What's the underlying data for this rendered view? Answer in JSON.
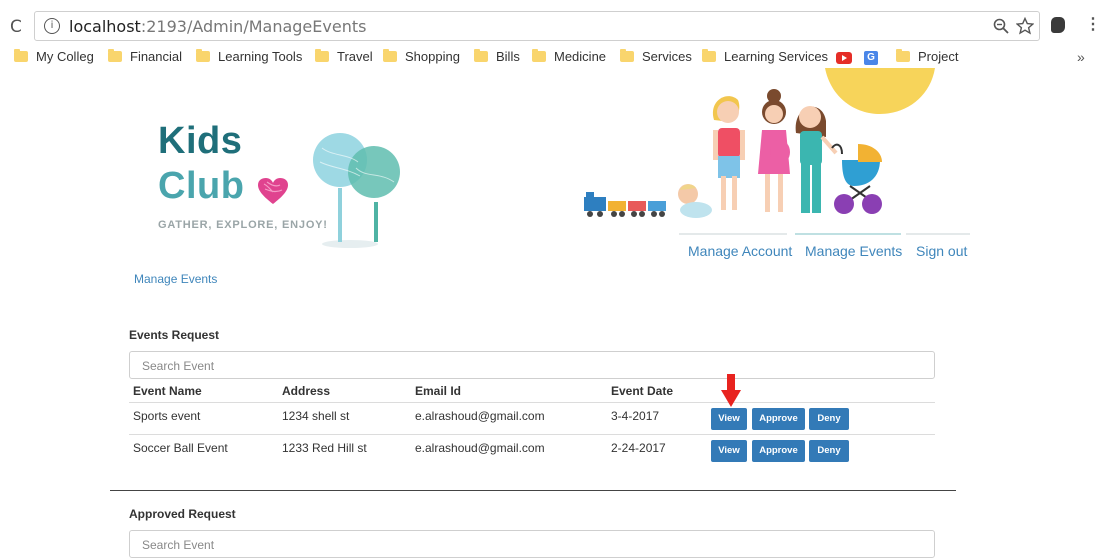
{
  "browser": {
    "url_host": "localhost",
    "url_path": ":2193/Admin/ManageEvents",
    "bookmarks": [
      {
        "label": "My Colleg"
      },
      {
        "label": "Financial"
      },
      {
        "label": "Learning Tools"
      },
      {
        "label": "Travel"
      },
      {
        "label": "Shopping"
      },
      {
        "label": "Bills"
      },
      {
        "label": "Medicine"
      },
      {
        "label": "Services"
      },
      {
        "label": "Learning Services"
      },
      {
        "label": "Project"
      }
    ],
    "more_bookmarks": "»",
    "icons": [
      "reload-icon",
      "info-icon",
      "zoom-icon",
      "star-icon",
      "extension-icon",
      "menu-icon",
      "youtube-icon",
      "translate-icon"
    ]
  },
  "brand": {
    "line1": "Kids",
    "line2": "Club",
    "tagline": "GATHER, EXPLORE, ENJOY!",
    "colors": {
      "dark_teal": "#1f6f7a",
      "light_teal": "#4aa5ad",
      "heart": "#e0438f",
      "link": "#3f86bb",
      "button": "#337ab7",
      "arrow": "#e8231f"
    }
  },
  "nav": {
    "items": [
      {
        "label": "Manage Account",
        "active": false
      },
      {
        "label": "Manage Events",
        "active": true
      },
      {
        "label": "Sign out",
        "active": false
      }
    ]
  },
  "breadcrumb": "Manage Events",
  "events_request": {
    "title": "Events Request",
    "search_placeholder": "Search Event",
    "columns": [
      "Event Name",
      "Address",
      "Email Id",
      "Event Date"
    ],
    "rows": [
      {
        "name": "Sports event",
        "address": "1234 shell st",
        "email": "e.alrashoud@gmail.com",
        "date": "3-4-2017"
      },
      {
        "name": "Soccer Ball Event",
        "address": "1233 Red Hill st",
        "email": "e.alrashoud@gmail.com",
        "date": "2-24-2017"
      }
    ],
    "actions": {
      "view": "View",
      "approve": "Approve",
      "deny": "Deny"
    }
  },
  "approved_request": {
    "title": "Approved Request",
    "search_placeholder": "Search Event"
  }
}
